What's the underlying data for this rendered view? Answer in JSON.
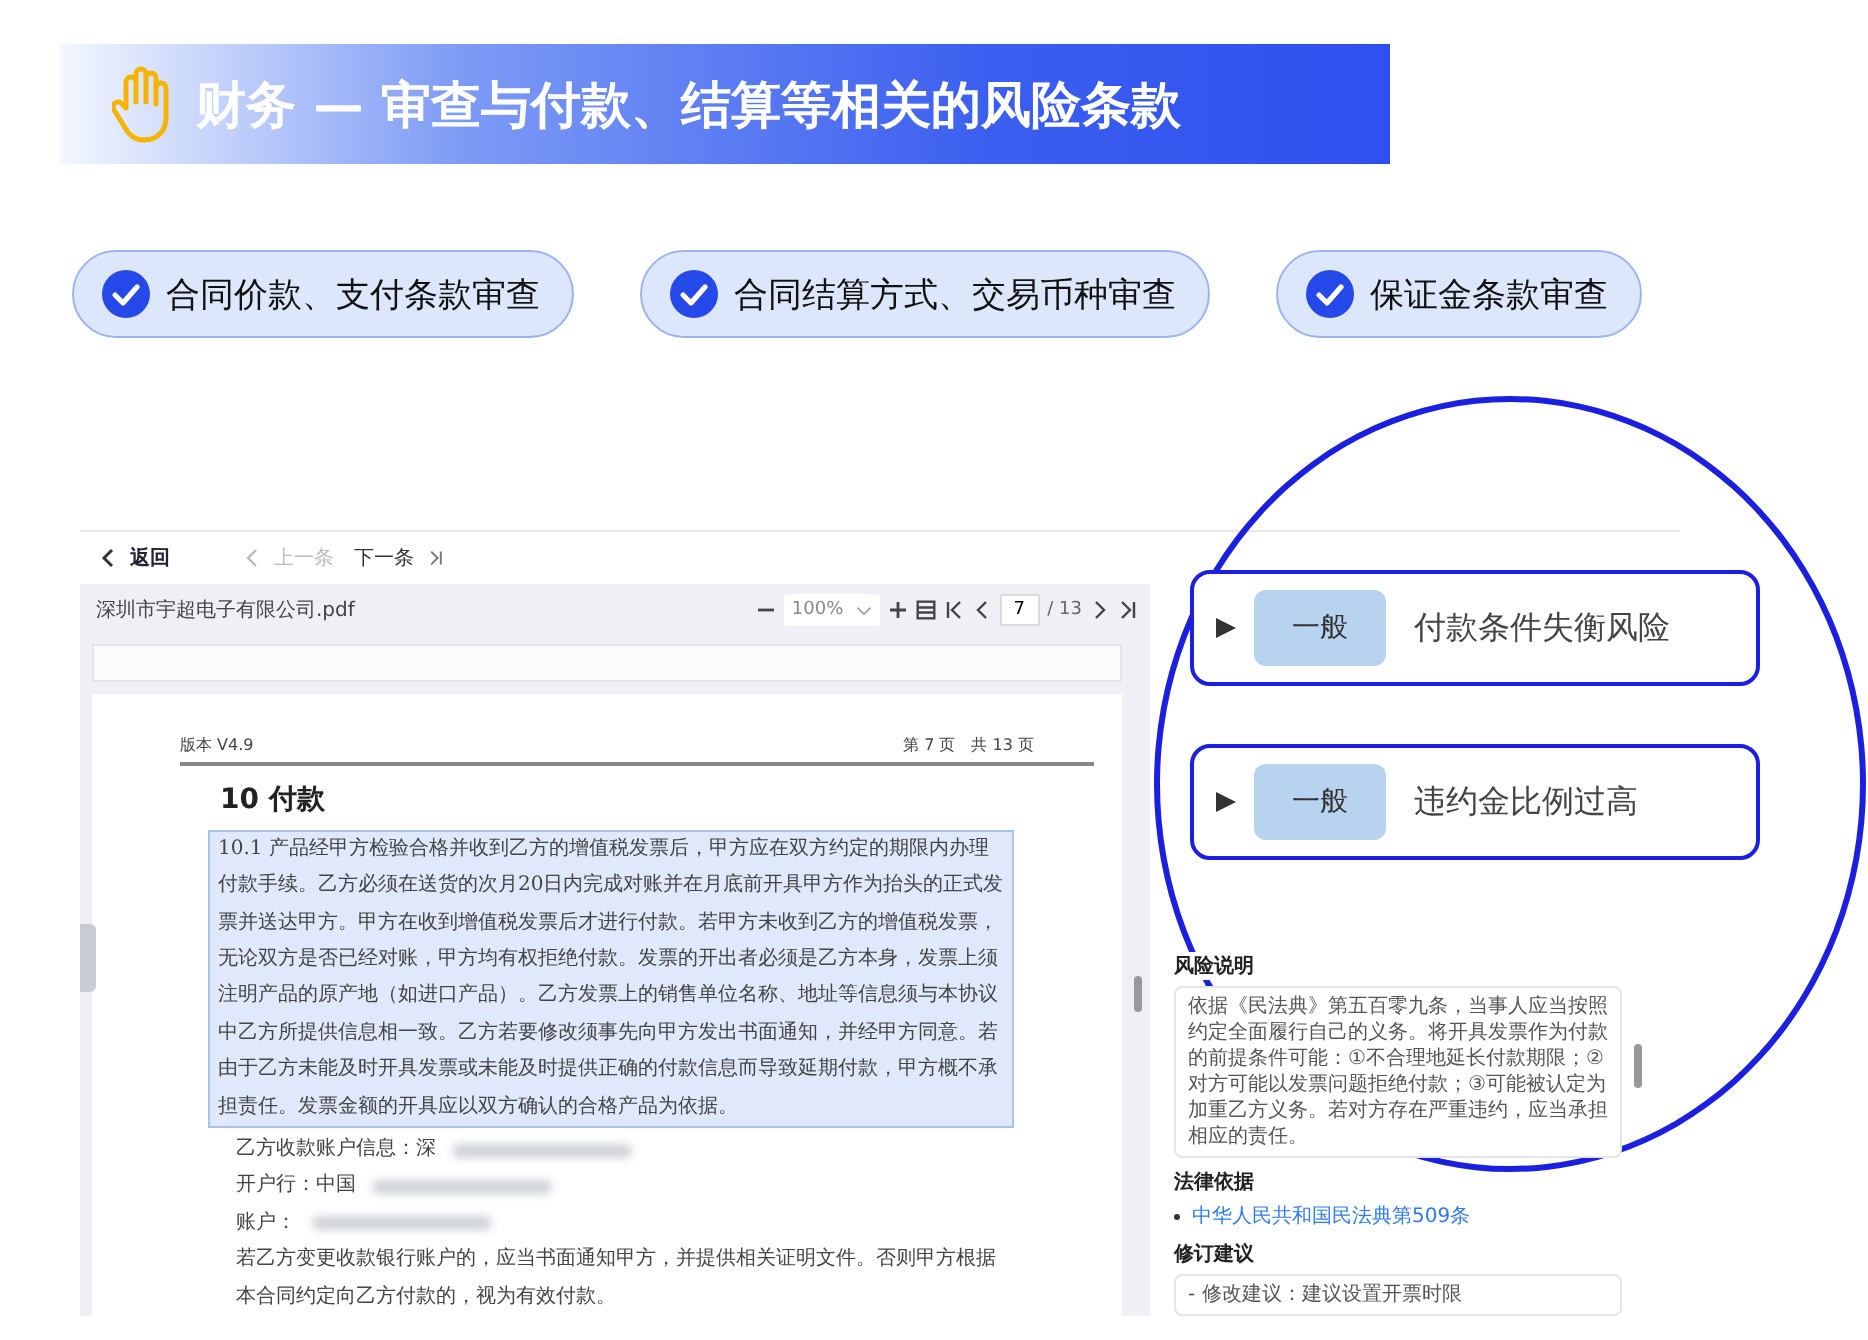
{
  "banner": {
    "title": "财务 — 审查与付款、结算等相关的风险条款"
  },
  "features": [
    {
      "label": "合同价款、支付条款审查",
      "checked": true
    },
    {
      "label": "合同结算方式、交易币种审查",
      "checked": true
    },
    {
      "label": "保证金条款审查",
      "checked": true
    }
  ],
  "app": {
    "nav": {
      "back": "返回",
      "prev": "上一条",
      "next": "下一条"
    },
    "toolbar": {
      "file_name": "深圳市宇超电子有限公司.pdf",
      "zoom": "100%",
      "page": "7",
      "page_total": "/ 13"
    },
    "document": {
      "header_left": "版本 V4.9",
      "header_right": "第 7 页　共 13 页",
      "section_title": "10 付款",
      "paragraphs": [
        {
          "text": "10.1 产品经甲方检验合格并收到乙方的增值税发票后，甲方应在双方约定的期限内办理付款手续。乙方必须在送货的次月20日内完成对账并在月底前开具甲方作为抬头的正式发票并送达甲方。甲方在收到增值税发票后才进行付款。若甲方未收到乙方的增值税发票，无论双方是否已经对账，甲方均有权拒绝付款。发票的开出者必须是乙方本身，发票上须注明产品的原产地（如进口产品）。乙方发票上的销售单位名称、地址等信息须与本协议中乙方所提供信息相一致。乙方若要修改须事先向甲方发出书面通知，并经甲方同意。若由于乙方未能及时开具发票或未能及时提供正确的付款信息而导致延期付款，甲方概不承担责任。发票金额的开具应以双方确认的合格产品为依据。",
          "selected": true,
          "redacted": false
        },
        {
          "text": "乙方收款账户信息：深",
          "selected": false,
          "redacted": true
        },
        {
          "text": "开户行：中国",
          "selected": false,
          "redacted": true
        },
        {
          "text": "账户：",
          "selected": false,
          "redacted": true
        },
        {
          "text": "若乙方变更收款银行账户的，应当书面通知甲方，并提供相关证明文件。否则甲方根据本合同约定向乙方付款的，视为有效付款。",
          "selected": false,
          "redacted": false
        }
      ]
    },
    "risk_panel": {
      "sections": [
        {
          "heading": "风险说明",
          "kind": "box",
          "text": "依据《民法典》第五百零九条，当事人应当按照约定全面履行自己的义务。将开具发票作为付款的前提条件可能：①不合理地延长付款期限；②对方可能以发票问题拒绝付款；③可能被认定为加重乙方义务。若对方存在严重违约，应当承担相应的责任。"
        },
        {
          "heading": "法律依据",
          "kind": "link",
          "text": "中华人民共和国民法典第509条"
        },
        {
          "heading": "修订建议",
          "kind": "box",
          "text": "- 修改建议：建议设置开票时限"
        }
      ]
    }
  },
  "callouts": [
    {
      "level": "一般",
      "title": "付款条件失衡风险"
    },
    {
      "level": "一般",
      "title": "违约金比例过高"
    }
  ]
}
